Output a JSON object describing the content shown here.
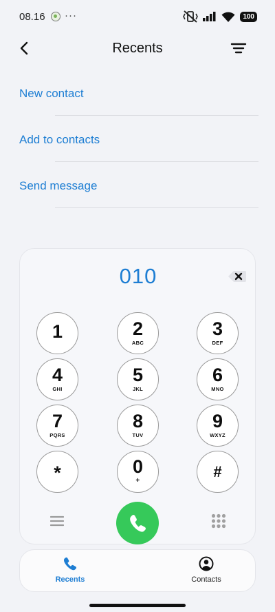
{
  "status_bar": {
    "time": "08.16",
    "overflow": "···",
    "battery": "100",
    "icons": [
      "app-notification-icon",
      "vibrate-off-icon",
      "signal-icon",
      "wifi-icon",
      "battery-icon"
    ]
  },
  "header": {
    "title": "Recents",
    "back_icon": "chevron-left-icon",
    "filter_icon": "filter-icon"
  },
  "actions": {
    "new_contact": "New contact",
    "add_to_contacts": "Add to contacts",
    "send_message": "Send message"
  },
  "dialer": {
    "number": "010",
    "backspace_icon": "backspace-icon",
    "keys": [
      {
        "digit": "1",
        "letters": ""
      },
      {
        "digit": "2",
        "letters": "ABC"
      },
      {
        "digit": "3",
        "letters": "DEF"
      },
      {
        "digit": "4",
        "letters": "GHI"
      },
      {
        "digit": "5",
        "letters": "JKL"
      },
      {
        "digit": "6",
        "letters": "MNO"
      },
      {
        "digit": "7",
        "letters": "PQRS"
      },
      {
        "digit": "8",
        "letters": "TUV"
      },
      {
        "digit": "9",
        "letters": "WXYZ"
      },
      {
        "digit": "*",
        "letters": ""
      },
      {
        "digit": "0",
        "letters": "+"
      },
      {
        "digit": "#",
        "letters": ""
      }
    ],
    "call_icon": "phone-icon",
    "call_color": "#36c95a"
  },
  "bottom_nav": {
    "recents": "Recents",
    "contacts": "Contacts",
    "active": "Recents",
    "accent": "#1e7ed3"
  }
}
